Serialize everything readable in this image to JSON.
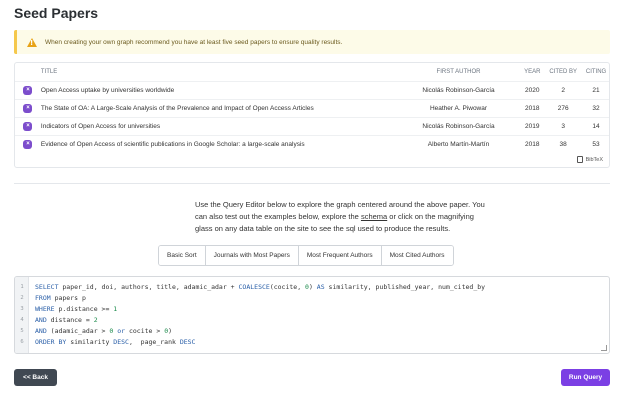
{
  "page": {
    "title": "Seed Papers"
  },
  "alert": {
    "text": "When creating your own graph recommend you have at least five seed papers to ensure quality results."
  },
  "table": {
    "headers": {
      "title": "TITLE",
      "author": "FIRST AUTHOR",
      "year": "YEAR",
      "cited_by": "CITED BY",
      "citing": "CITING"
    },
    "rows": [
      {
        "title": "Open Access uptake by universities worldwide",
        "author": "Nicolás Robinson-García",
        "year": "2020",
        "cited_by": "2",
        "citing": "21"
      },
      {
        "title": "The State of OA: A Large-Scale Analysis of the Prevalence and Impact of Open Access Articles",
        "author": "Heather A. Piwowar",
        "year": "2018",
        "cited_by": "276",
        "citing": "32"
      },
      {
        "title": "Indicators of Open Access for universities",
        "author": "Nicolás Robinson-García",
        "year": "2019",
        "cited_by": "3",
        "citing": "14"
      },
      {
        "title": "Evidence of Open Access of scientific publications in Google Scholar: a large-scale analysis",
        "author": "Alberto Martín-Martín",
        "year": "2018",
        "cited_by": "38",
        "citing": "53"
      }
    ],
    "remove_symbol": "×",
    "bibtex_label": "BibTeX"
  },
  "description": {
    "part1": "Use the Query Editor below to explore the graph centered around the above paper. You can also test out the examples below, explore the ",
    "link": "schema",
    "part2": " or click on the magnifying glass on any data table on the site to see the sql used to produce the results."
  },
  "query_buttons": [
    "Basic Sort",
    "Journals with Most Papers",
    "Most Frequent Authors",
    "Most Cited Authors"
  ],
  "editor": {
    "line_numbers": [
      "1",
      "2",
      "3",
      "4",
      "5",
      "6"
    ]
  },
  "buttons": {
    "back": "<< Back",
    "run": "Run Query"
  },
  "colors": {
    "accent": "#7b3fe4",
    "back_button": "#404852",
    "alert_border": "#f5c84c",
    "remove_icon": "#7c4dcc"
  },
  "icons": {
    "alert": "warning-icon",
    "remove": "remove-x-icon",
    "bibtex": "document-icon"
  }
}
